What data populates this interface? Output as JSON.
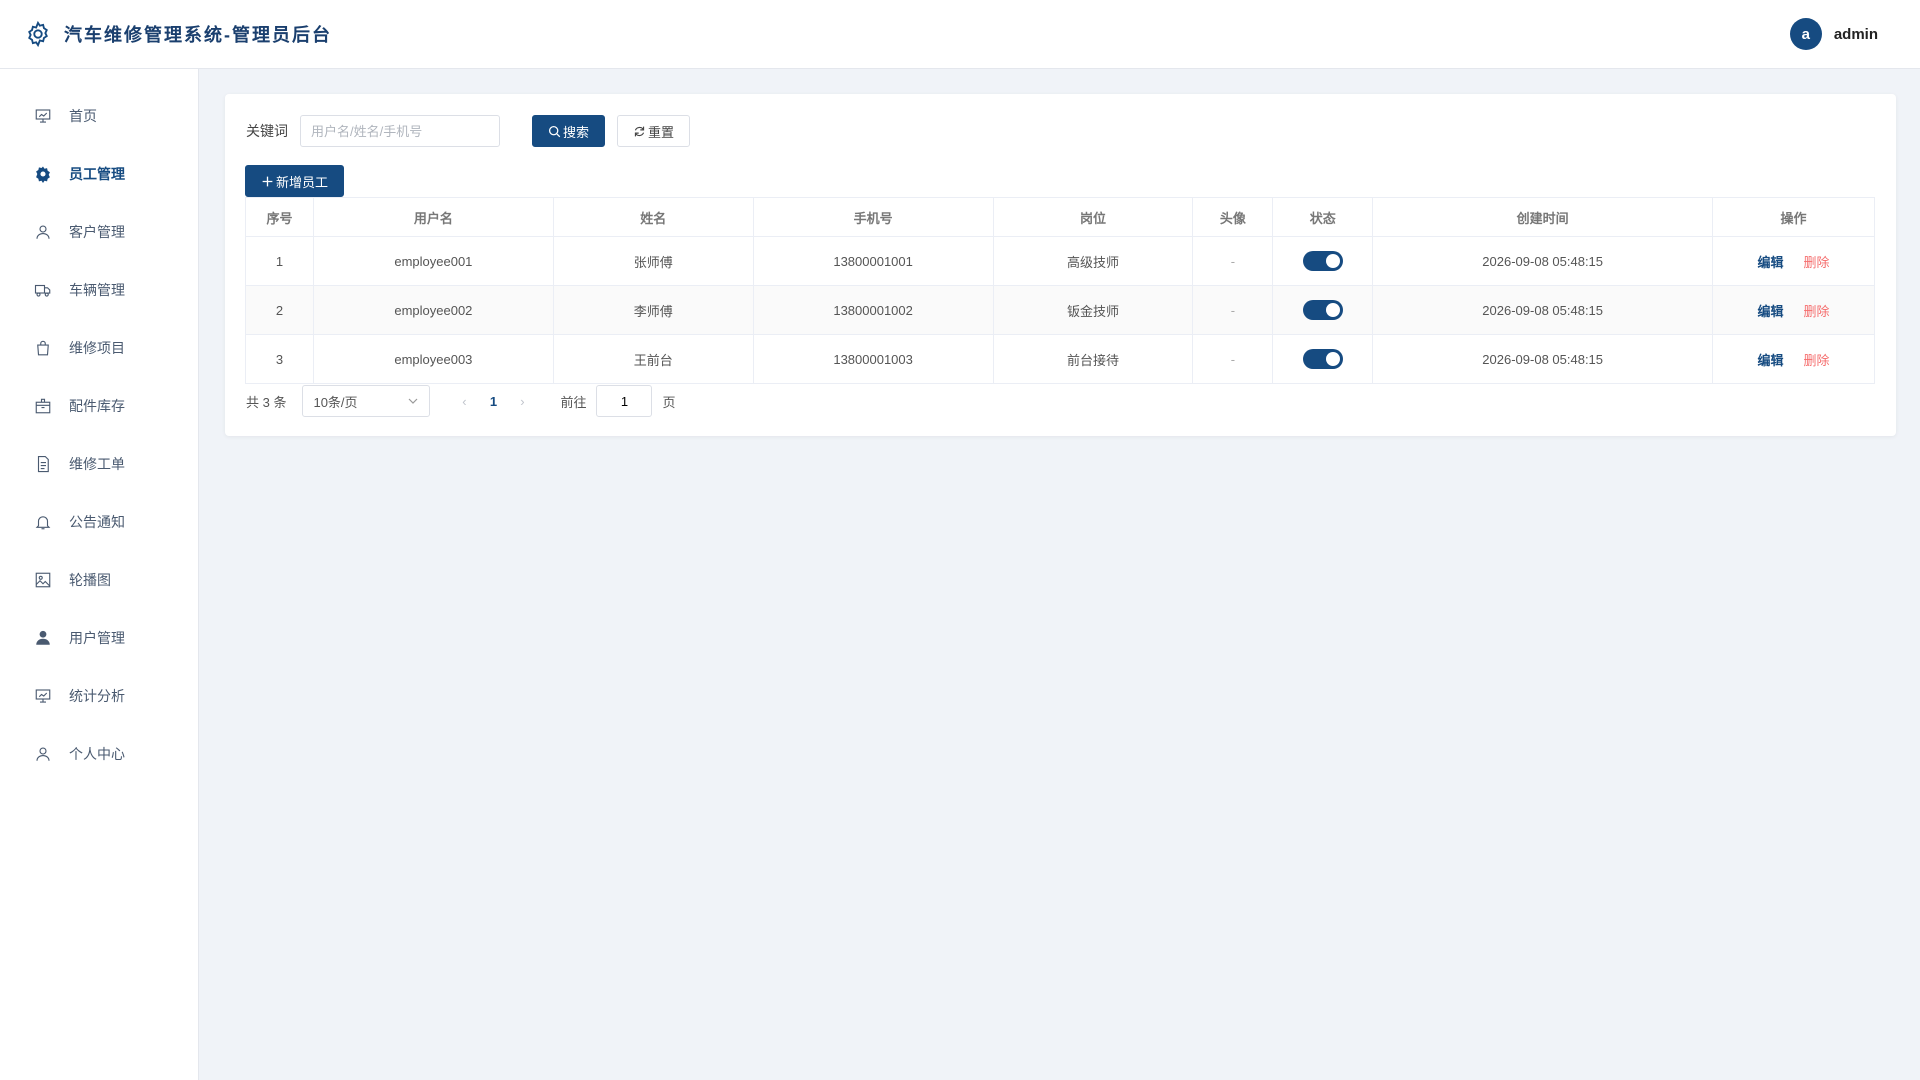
{
  "header": {
    "title": "汽车维修管理系统-管理员后台",
    "avatar_letter": "a",
    "username": "admin",
    "accent": "#164b81"
  },
  "sidebar": {
    "items": [
      {
        "label": "首页",
        "icon": "presentation-board-icon",
        "active": false
      },
      {
        "label": "员工管理",
        "icon": "gear-icon",
        "active": true
      },
      {
        "label": "客户管理",
        "icon": "user-icon",
        "active": false
      },
      {
        "label": "车辆管理",
        "icon": "truck-icon",
        "active": false
      },
      {
        "label": "维修项目",
        "icon": "shopping-bag-icon",
        "active": false
      },
      {
        "label": "配件库存",
        "icon": "box-icon",
        "active": false
      },
      {
        "label": "维修工单",
        "icon": "document-icon",
        "active": false
      },
      {
        "label": "公告通知",
        "icon": "bell-icon",
        "active": false
      },
      {
        "label": "轮播图",
        "icon": "picture-icon",
        "active": false
      },
      {
        "label": "用户管理",
        "icon": "user-filled-icon",
        "active": false
      },
      {
        "label": "统计分析",
        "icon": "presentation-board-icon",
        "active": false
      },
      {
        "label": "个人中心",
        "icon": "user-icon",
        "active": false
      }
    ]
  },
  "search": {
    "label": "关键词",
    "placeholder": "用户名/姓名/手机号",
    "value": "",
    "search_label": "搜索",
    "reset_label": "重置"
  },
  "toolbar": {
    "add_label": "新增员工"
  },
  "table": {
    "columns": [
      "序号",
      "用户名",
      "姓名",
      "手机号",
      "岗位",
      "头像",
      "状态",
      "创建时间",
      "操作"
    ],
    "rows": [
      {
        "index": "1",
        "username": "employee001",
        "name": "张师傅",
        "phone": "13800001001",
        "position": "高级技师",
        "avatar": "-",
        "status": true,
        "created": "2026-09-08 05:48:15"
      },
      {
        "index": "2",
        "username": "employee002",
        "name": "李师傅",
        "phone": "13800001002",
        "position": "钣金技师",
        "avatar": "-",
        "status": true,
        "created": "2026-09-08 05:48:15"
      },
      {
        "index": "3",
        "username": "employee003",
        "name": "王前台",
        "phone": "13800001003",
        "position": "前台接待",
        "avatar": "-",
        "status": true,
        "created": "2026-09-08 05:48:15"
      }
    ],
    "edit_label": "编辑",
    "delete_label": "删除"
  },
  "pagination": {
    "total_text": "共 3 条",
    "page_size": "10条/页",
    "current_page": "1",
    "goto_label": "前往",
    "goto_value": "1",
    "page_suffix": "页"
  }
}
